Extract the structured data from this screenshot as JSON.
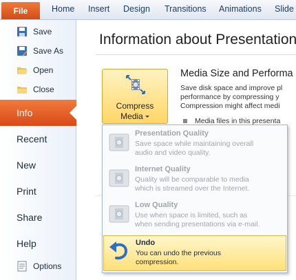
{
  "ribbon": {
    "file_tab": "File",
    "tabs": [
      "Home",
      "Insert",
      "Design",
      "Transitions",
      "Animations",
      "Slide"
    ]
  },
  "backstage": {
    "commands": [
      {
        "label": "Save",
        "icon": "save-icon"
      },
      {
        "label": "Save As",
        "icon": "save-as-icon"
      },
      {
        "label": "Open",
        "icon": "open-folder-icon"
      },
      {
        "label": "Close",
        "icon": "close-folder-icon"
      }
    ],
    "nav": {
      "selected": "Info",
      "items": [
        "Recent",
        "New",
        "Print",
        "Share",
        "Help"
      ],
      "options": {
        "label": "Options",
        "icon": "options-icon"
      }
    }
  },
  "main": {
    "page_title": "Information about Presentation",
    "compress": {
      "line1": "Compress",
      "line2": "Media",
      "icon": "compress-media-icon"
    },
    "section_heading": "Media Size and Performa",
    "section_desc": [
      "Save disk space and improve pl",
      "performance by compressing y",
      "Compression might affect medi"
    ],
    "bullet": "Media files in this presenta"
  },
  "dropdown": {
    "items": [
      {
        "title": "Presentation Quality",
        "desc": [
          "Save space while maintaining overall",
          "audio and video quality."
        ],
        "enabled": false
      },
      {
        "title": "Internet Quality",
        "desc": [
          "Quality will be comparable to media",
          "which is streamed over the Internet."
        ],
        "enabled": false
      },
      {
        "title": "Low Quality",
        "desc": [
          "Use when space is limited, such as",
          "when sending presentations via e-mail."
        ],
        "enabled": false
      },
      {
        "title": "Undo",
        "desc": [
          "You can undo the previous",
          "compression."
        ],
        "enabled": true,
        "highlighted": true
      }
    ]
  },
  "colors": {
    "file_tab": "#d24b16",
    "info_selected": "#e05a20",
    "highlight": "#ffe079",
    "ribbon_text": "#1e395b"
  }
}
